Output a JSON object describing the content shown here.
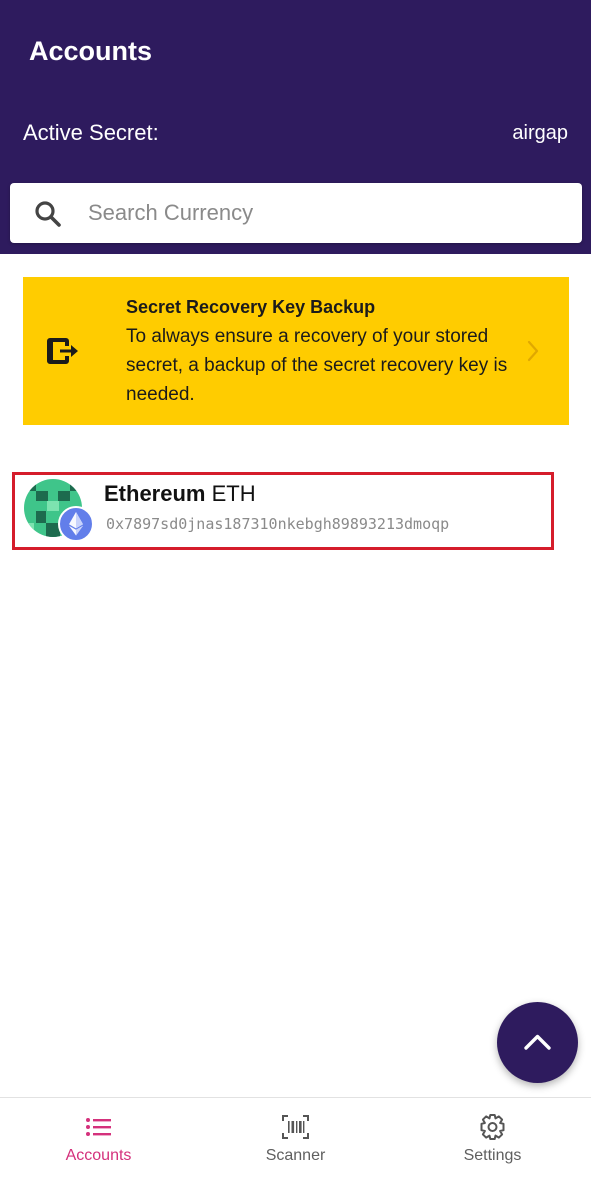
{
  "header": {
    "title": "Accounts",
    "active_secret_label": "Active Secret:",
    "active_secret_value": "airgap",
    "background_color": "#2e1b5e"
  },
  "search": {
    "placeholder": "Search Currency",
    "value": "",
    "icon": "search-icon"
  },
  "backup_banner": {
    "title": "Secret Recovery Key Backup",
    "text": "To always ensure a recovery of your stored secret, a backup of the secret recovery key is needed.",
    "icon": "exit-to-app-icon",
    "background_color": "#ffcc00"
  },
  "accounts": [
    {
      "name": "Ethereum",
      "symbol": "ETH",
      "address": "0x7897sd0jnas187310nkebgh89893213dmoqp",
      "icon": "ethereum-icon"
    }
  ],
  "fab": {
    "icon": "chevron-up-icon"
  },
  "tabs": [
    {
      "label": "Accounts",
      "icon": "list-icon",
      "active": true
    },
    {
      "label": "Scanner",
      "icon": "barcode-scanner-icon",
      "active": false
    },
    {
      "label": "Settings",
      "icon": "gear-icon",
      "active": false
    }
  ],
  "colors": {
    "accent": "#d4317c",
    "highlight_border": "#d51d2b"
  }
}
